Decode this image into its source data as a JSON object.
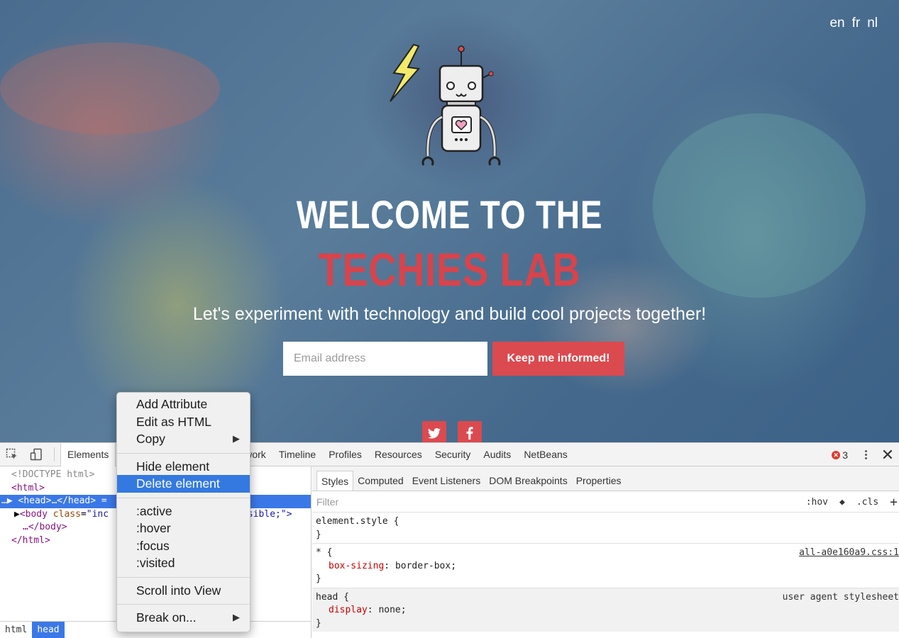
{
  "hero": {
    "languages": [
      "en",
      "fr",
      "nl"
    ],
    "welcome": "WELCOME TO THE",
    "brand": "TECHIES LAB",
    "tagline": "Let's experiment with technology and build cool projects together!",
    "email_placeholder": "Email address",
    "cta_label": "Keep me informed!",
    "brand_color": "#db4a4f",
    "social_icons": [
      "twitter-icon",
      "facebook-icon"
    ]
  },
  "devtools": {
    "tabs": [
      "Elements",
      "Network",
      "Timeline",
      "Profiles",
      "Resources",
      "Security",
      "Audits",
      "NetBeans"
    ],
    "visible_tab_fragment": "twork",
    "active_tab": "Elements",
    "error_count": "3",
    "dom": {
      "doctype": "<!DOCTYPE html>",
      "html_open": "html",
      "head_tag": "head",
      "head_ellipsis": "…",
      "head_close": "/head",
      "body_tag": "body",
      "body_attr": "class",
      "body_val_fragment": "\"inc",
      "body_style_fragment": "isible;\">",
      "body_close": "…</body>",
      "html_close": "</html>"
    },
    "breadcrumbs": [
      "html",
      "head"
    ],
    "sub_tabs": [
      "Styles",
      "Computed",
      "Event Listeners",
      "DOM Breakpoints",
      "Properties"
    ],
    "filter_placeholder": "Filter",
    "filter_tools": [
      ":hov",
      ".cls",
      "+"
    ],
    "rules": [
      {
        "selector": "element.style {",
        "close": "}",
        "props": [],
        "source": ""
      },
      {
        "selector": "* {",
        "close": "}",
        "prop_name": "box-sizing",
        "prop_value": "border-box;",
        "source": "all-a0e160a9.css:1"
      },
      {
        "selector": "head {",
        "close": "}",
        "prop_name": "display",
        "prop_value": "none;",
        "source": "user agent stylesheet"
      }
    ]
  },
  "context_menu": {
    "groups": [
      [
        "Add Attribute",
        "Edit as HTML",
        "Copy"
      ],
      [
        "Hide element",
        "Delete element"
      ],
      [
        ":active",
        ":hover",
        ":focus",
        ":visited"
      ],
      [
        "Scroll into View"
      ],
      [
        "Break on..."
      ]
    ],
    "highlighted": "Delete element"
  }
}
